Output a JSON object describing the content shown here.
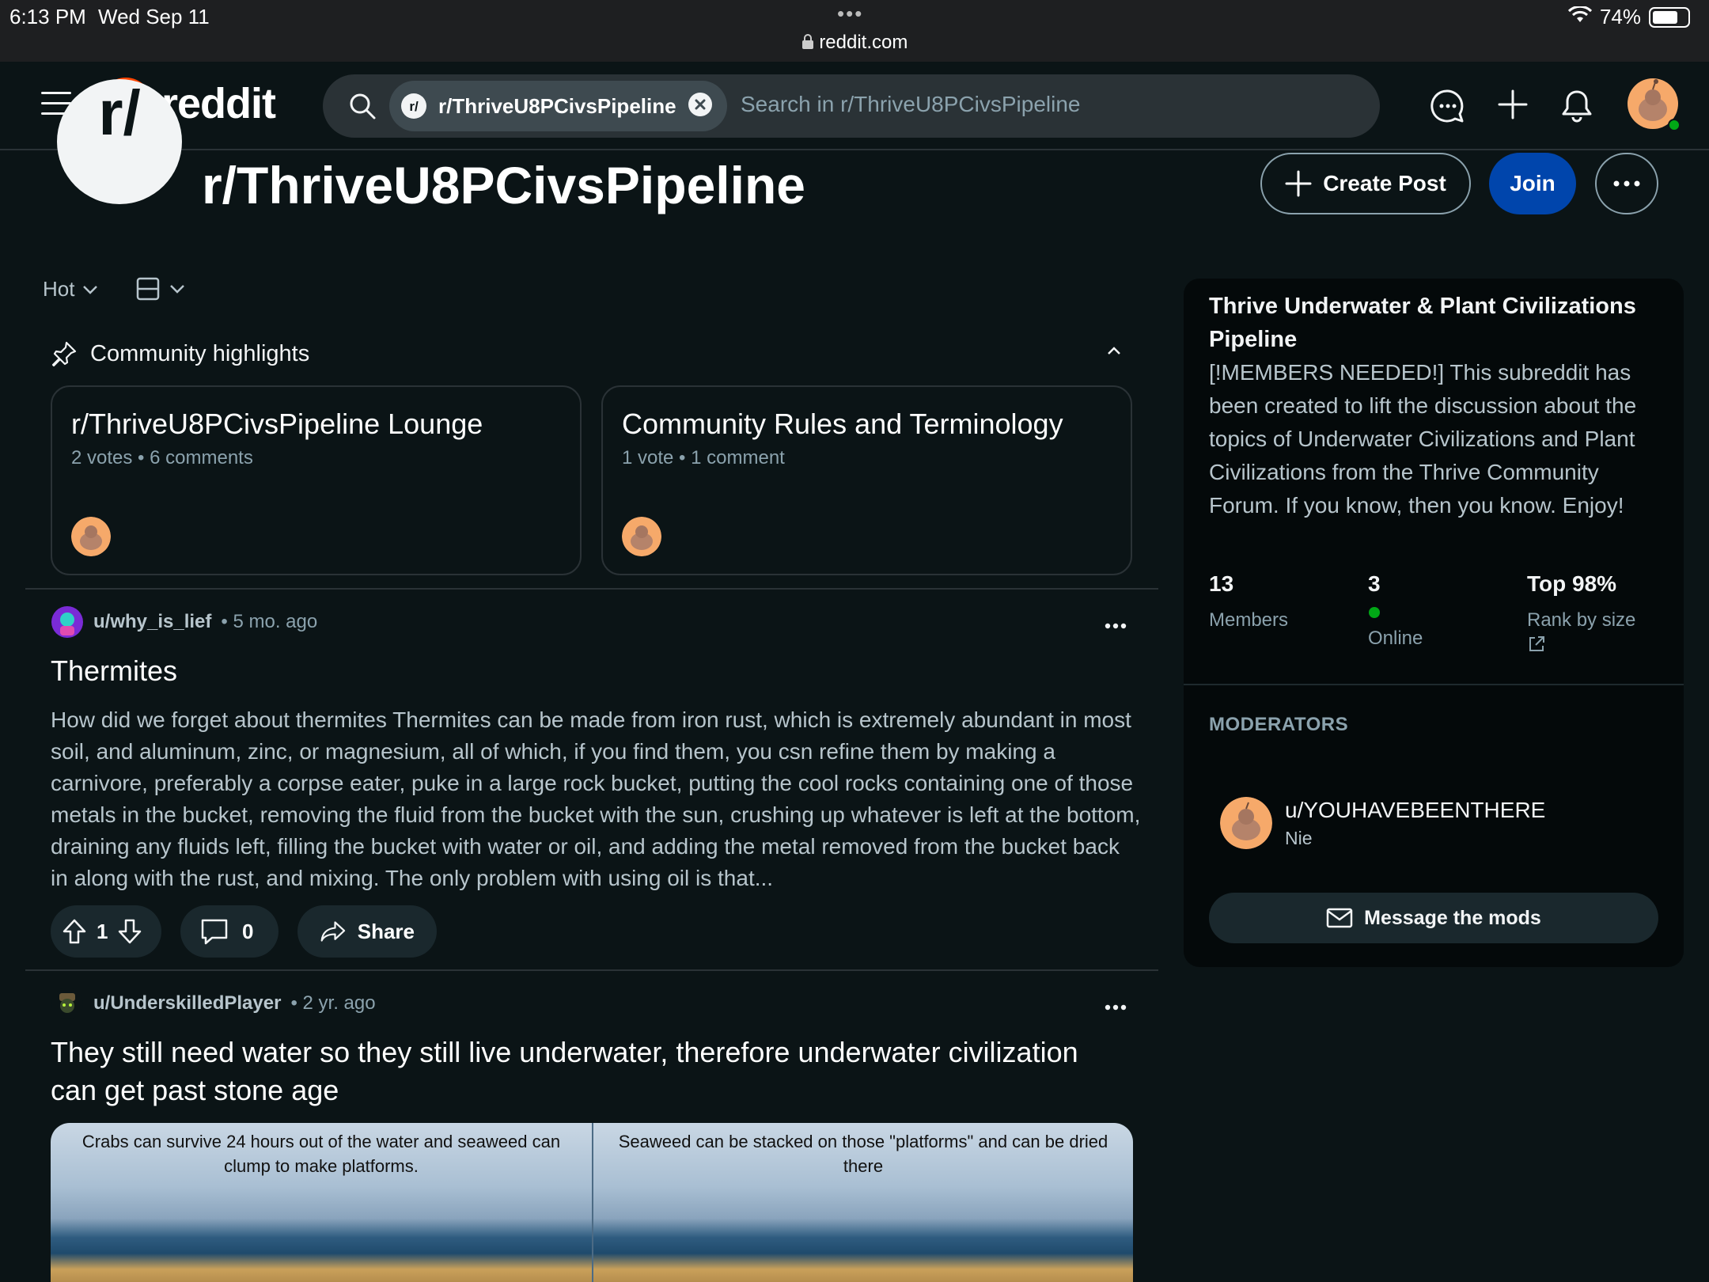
{
  "status_bar": {
    "time": "6:13 PM",
    "date": "Wed Sep 11",
    "url": "reddit.com",
    "battery": "74%",
    "battery_level": 0.74
  },
  "header": {
    "logo_text": "reddit",
    "search_chip": "r/ThriveU8PCivsPipeline",
    "search_placeholder": "Search in r/ThriveU8PCivsPipeline"
  },
  "community": {
    "name": "r/ThriveU8PCivsPipeline",
    "avatar_glyph": "r/",
    "create_post": "Create Post",
    "join": "Join"
  },
  "sort": {
    "label": "Hot"
  },
  "highlights": {
    "heading": "Community highlights",
    "cards": [
      {
        "title": "r/ThriveU8PCivsPipeline Lounge",
        "meta": "2 votes • 6 comments"
      },
      {
        "title": "Community Rules and Terminology",
        "meta": "1 vote • 1 comment"
      }
    ]
  },
  "posts": [
    {
      "user": "u/why_is_lief",
      "age": "• 5 mo. ago",
      "title": "Thermites",
      "body": "How did we forget about thermites Thermites can be made from iron rust, which is extremely abundant in most soil, and aluminum, zinc, or magnesium, all of which, if you find them, you csn refine them by making a carnivore, preferably a corpse eater, puke in a large rock bucket, putting the cool rocks containing one of those metals in the bucket, removing the fluid from the bucket with the sun, crushing up whatever is left at the bottom, draining any fluids left, filling the bucket with water or oil, and adding the metal removed from the bucket back in along with the rust, and mixing. The only problem with using oil is that...",
      "votes": "1",
      "comments": "0",
      "share": "Share"
    },
    {
      "user": "u/UnderskilledPlayer",
      "age": "• 2 yr. ago",
      "title": "They still need water so they still live underwater, therefore underwater civilization can get past stone age",
      "image_captions": [
        "Crabs can survive 24 hours out of the water and seaweed can clump to make platforms.",
        "Seaweed can be stacked on those \"platforms\" and can be dried there"
      ]
    }
  ],
  "sidebar": {
    "title": "Thrive Underwater & Plant Civilizations Pipeline",
    "description": "[!MEMBERS NEEDED!] This subreddit has been created to lift the discussion about the topics of Underwater Civilizations and Plant Civilizations from the Thrive Community Forum. If you know, then you know. Enjoy!",
    "stats": [
      {
        "value": "13",
        "label": "Members"
      },
      {
        "value": "3",
        "label": "Online"
      },
      {
        "value": "Top 98%",
        "label": "Rank by size"
      }
    ],
    "moderators_heading": "MODERATORS",
    "moderator": {
      "name": "u/YOUHAVEBEENTHERE",
      "flair": "Nie"
    },
    "message_button": "Message the mods"
  },
  "colors": {
    "background": "#0b1416",
    "join_button": "#0045ac",
    "reddit_orange": "#ff4500",
    "online_dot": "#01a816"
  }
}
